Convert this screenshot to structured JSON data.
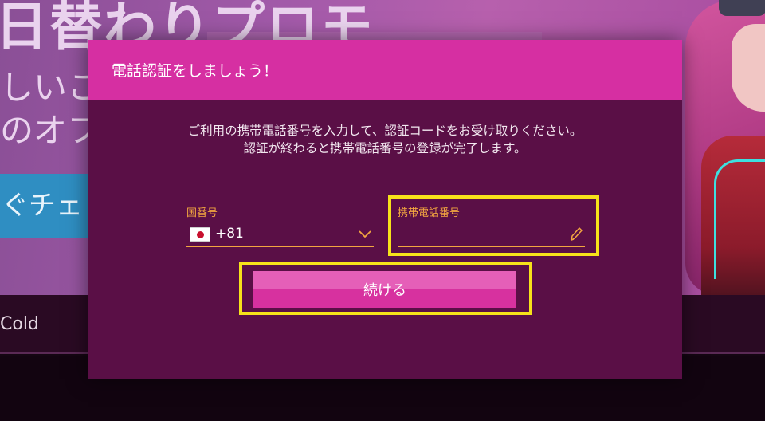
{
  "background": {
    "headline": "日替わりプロモ",
    "subtext_line1": "しいこ",
    "subtext_line2": "のオフ",
    "check_button_label": "ぐチェッ",
    "strip_text": "Cold"
  },
  "modal": {
    "title": "電話認証をしましょう！",
    "description": "ご利用の携帯電話番号を入力して、認証コードをお受け取りください。認証が終わると携帯電話番号の登録が完了します。",
    "country_field": {
      "label": "国番号",
      "value": "+81",
      "flag": "japan-flag"
    },
    "phone_field": {
      "label": "携帯電話番号",
      "value": "",
      "icon": "pencil-icon"
    },
    "continue_label": "続ける"
  },
  "colors": {
    "modal_background": "#5a0f46",
    "header_pink": "#d62fa2",
    "accent_orange": "#f2a640",
    "highlight_yellow": "#f6e21a",
    "button_pink": "#d7319f"
  }
}
